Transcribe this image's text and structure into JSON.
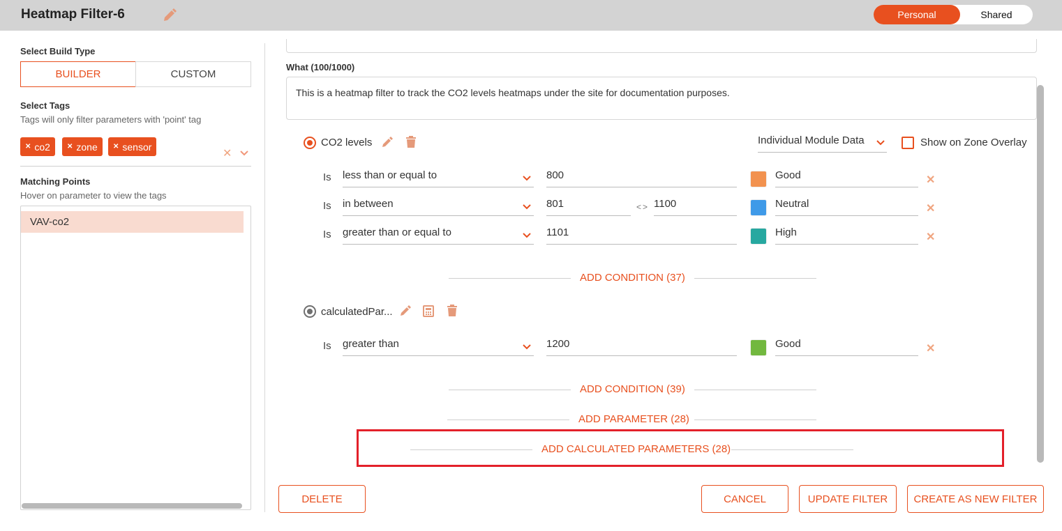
{
  "header": {
    "title": "Heatmap Filter-6",
    "toggle": {
      "active": "Personal",
      "inactive": "Shared"
    }
  },
  "left": {
    "build_type_label": "Select Build Type",
    "builder_label": "BUILDER",
    "custom_label": "CUSTOM",
    "tags_label": "Select Tags",
    "tags_hint": "Tags will only filter parameters with 'point' tag",
    "tags": [
      "co2",
      "zone",
      "sensor"
    ],
    "matching_label": "Matching Points",
    "matching_hint": "Hover on parameter to view the tags",
    "matching_items": [
      "VAV-co2"
    ]
  },
  "form": {
    "what_label": "What (100/1000)",
    "what_text": "This is a heatmap filter to track the CO2 levels heatmaps under the site for documentation purposes."
  },
  "parameters": [
    {
      "name": "CO2 levels",
      "data_source": "Individual Module Data",
      "overlay_label": "Show on Zone Overlay",
      "conditions": [
        {
          "is": "Is",
          "operator": "less than or equal to",
          "value": "800",
          "value2": "",
          "color": "#f2924f",
          "label": "Good"
        },
        {
          "is": "Is",
          "operator": "in between",
          "value": "801",
          "between": "<>",
          "value2": "1100",
          "color": "#3f9ae8",
          "label": "Neutral"
        },
        {
          "is": "Is",
          "operator": "greater than or equal to",
          "value": "1101",
          "value2": "",
          "color": "#27a8a0",
          "label": "High"
        }
      ],
      "add_condition": "ADD CONDITION (37)"
    },
    {
      "name": "calculatedPar...",
      "conditions": [
        {
          "is": "Is",
          "operator": "greater than",
          "value": "1200",
          "color": "#72b83f",
          "label": "Good"
        }
      ],
      "add_condition": "ADD CONDITION (39)"
    }
  ],
  "actions": {
    "add_parameter": "ADD PARAMETER (28)",
    "add_calculated": "ADD CALCULATED PARAMETERS (28)",
    "delete": "DELETE",
    "cancel": "CANCEL",
    "update": "UPDATE FILTER",
    "create": "CREATE AS NEW FILTER"
  },
  "colors": {
    "accent": "#e8501f",
    "highlight_box": "#e3202a"
  }
}
